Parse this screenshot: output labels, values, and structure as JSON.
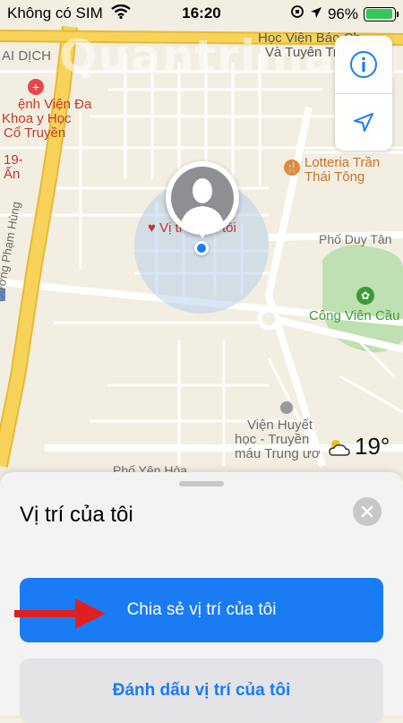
{
  "status_bar": {
    "carrier": "Không có SIM",
    "time": "16:20",
    "battery": "96%",
    "battery_level": 0.96
  },
  "map": {
    "labels": {
      "hoc_vien_bao_1": "Học Viện Báo Ch",
      "hoc_vien_bao_2": "Và Tuyên Tru",
      "ai_dich": "AI DỊCH",
      "benh_vien_1": "ệnh Viện Đa",
      "benh_vien_2": "Khoa y Học",
      "benh_vien_3": "Cổ Truyền",
      "nineteen": "19-",
      "an": "Ấn",
      "lotteria_1": "Lotteria Trần",
      "lotteria_2": "Thái Tông",
      "my_location_map": "Vị tr",
      "my_location_map_tail": "tôi",
      "pho_duy_tan": "Phố Duy Tân",
      "duong_pham_hung": "Đường Phạm Hùng",
      "cong_vien": "Công Viên Cầu G",
      "vien_huyet_1": "Viện Huyết",
      "vien_huyet_2": "học - Truyền",
      "vien_huyet_3": "máu Trung ươ",
      "pho_yen_hoa": "Phố Yên Hòa"
    },
    "watermark": "Quantrimang",
    "weather": {
      "temperature": "19°",
      "icon": "partly-cloudy-icon"
    },
    "controls": {
      "info_icon": "info-icon",
      "location_icon": "location-arrow-icon"
    }
  },
  "sheet": {
    "title": "Vị trí của tôi",
    "share_button": "Chia sẻ vị trí của tôi",
    "mark_button": "Đánh dấu vị trí của tôi"
  },
  "colors": {
    "accent": "#1a7cf5",
    "highway": "#f7d35a",
    "park": "#bfe0b0",
    "annotation_arrow": "#e02020"
  }
}
